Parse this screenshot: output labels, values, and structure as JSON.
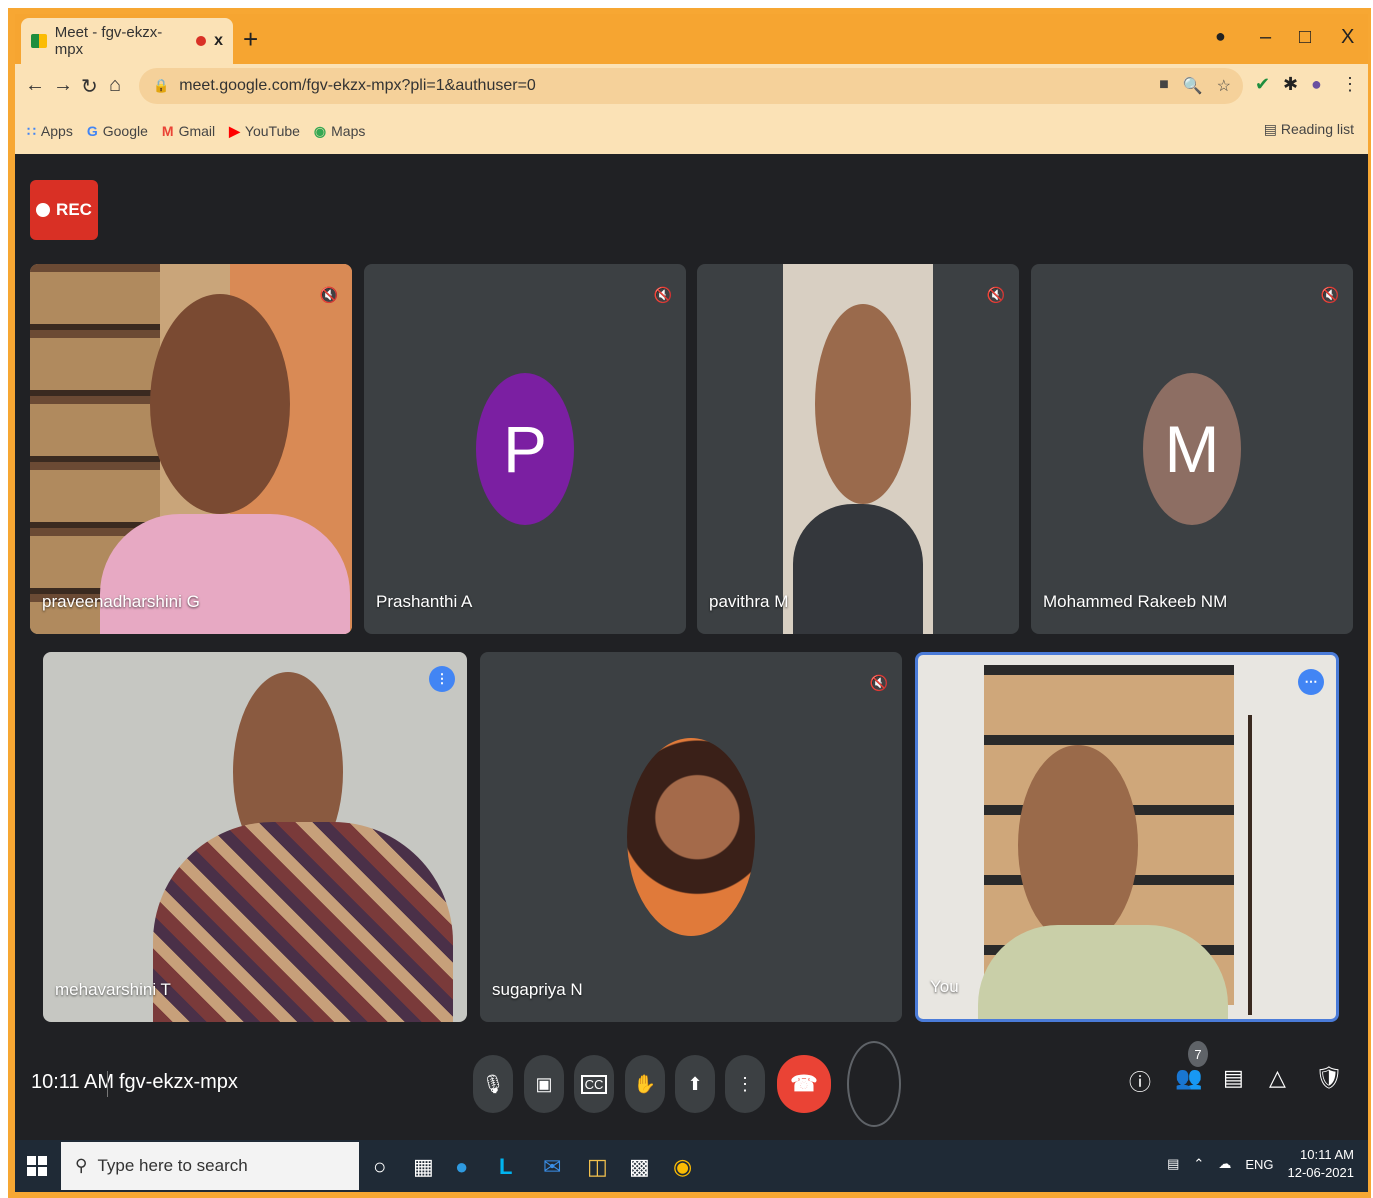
{
  "browser": {
    "tab_title": "Meet - fgv-ekzx-mpx",
    "tab_close": "x",
    "new_tab": "+",
    "url": "meet.google.com/fgv-ekzx-mpx?pli=1&authuser=0",
    "window": {
      "minimize": "–",
      "maximize": "□",
      "close": "X"
    },
    "nav": {
      "back": "←",
      "forward": "→",
      "reload": "↻",
      "home": "⌂"
    }
  },
  "bookmarks": {
    "items": [
      {
        "label": "Apps",
        "icon": "apps-icon",
        "glyph": "∷",
        "color": "#4285f4"
      },
      {
        "label": "Google",
        "icon": "google-icon",
        "glyph": "G",
        "color": "#4285f4"
      },
      {
        "label": "Gmail",
        "icon": "gmail-icon",
        "glyph": "M",
        "color": "#ea4335"
      },
      {
        "label": "YouTube",
        "icon": "youtube-icon",
        "glyph": "▶",
        "color": "#ff0000"
      },
      {
        "label": "Maps",
        "icon": "maps-icon",
        "glyph": "◉",
        "color": "#34a853"
      }
    ],
    "reading_list": "Reading list"
  },
  "meet": {
    "rec_label": "REC",
    "participants": [
      {
        "name": "praveenadharshini G",
        "muted": true
      },
      {
        "name": "Prashanthi A",
        "muted": true,
        "initial": "P",
        "avatar_color": "#7b1fa2"
      },
      {
        "name": "pavithra M",
        "muted": true
      },
      {
        "name": "Mohammed Rakeeb NM",
        "muted": true,
        "initial": "M",
        "avatar_color": "#8d6e63"
      },
      {
        "name": "mehavarshini T",
        "speaking": true
      },
      {
        "name": "sugapriya N",
        "muted": true
      },
      {
        "name": "You",
        "more": true
      }
    ],
    "time": "10:11 AM",
    "meeting_code": "fgv-ekzx-mpx",
    "people_count": "7"
  },
  "taskbar": {
    "search_placeholder": "Type here to search",
    "lang": "ENG",
    "clock_time": "10:11 AM",
    "clock_date": "12-06-2021"
  }
}
